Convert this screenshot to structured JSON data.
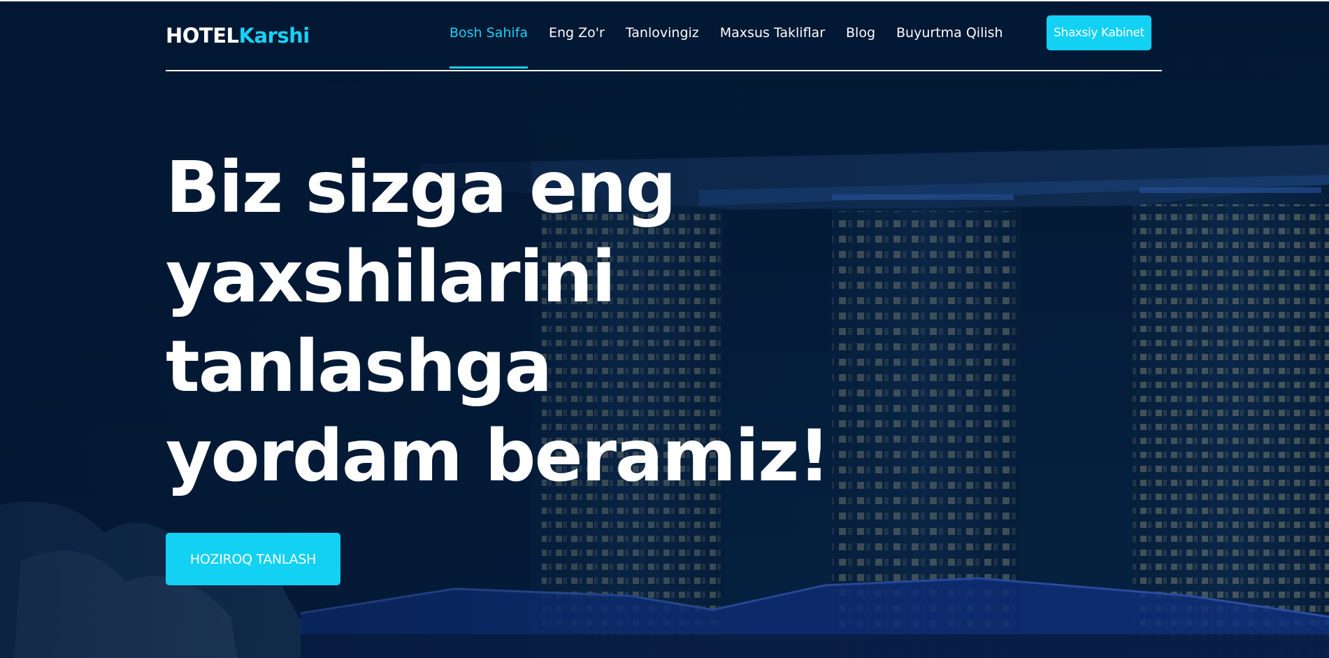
{
  "brand": {
    "logo_main": "HOTEL",
    "logo_accent": "Karshi",
    "accent_color": "#1ad0f5"
  },
  "nav": {
    "items": [
      {
        "label": "Bosh Sahifa",
        "active": true
      },
      {
        "label": "Eng Zo'r",
        "active": false
      },
      {
        "label": "Tanlovingiz",
        "active": false
      },
      {
        "label": "Maxsus Takliflar",
        "active": false
      },
      {
        "label": "Blog",
        "active": false
      },
      {
        "label": "Buyurtma Qilish",
        "active": false
      }
    ],
    "cabinet_label": "Shaxsiy Kabinet"
  },
  "hero": {
    "title_lines": [
      "Biz sizga eng",
      "yaxshilarini",
      "tanlashga",
      "yordam beramiz!"
    ],
    "cta_label": "HOZIROQ TANLASH"
  },
  "colors": {
    "background": "#061a33",
    "button": "#12d1f3",
    "text": "#ffffff"
  }
}
